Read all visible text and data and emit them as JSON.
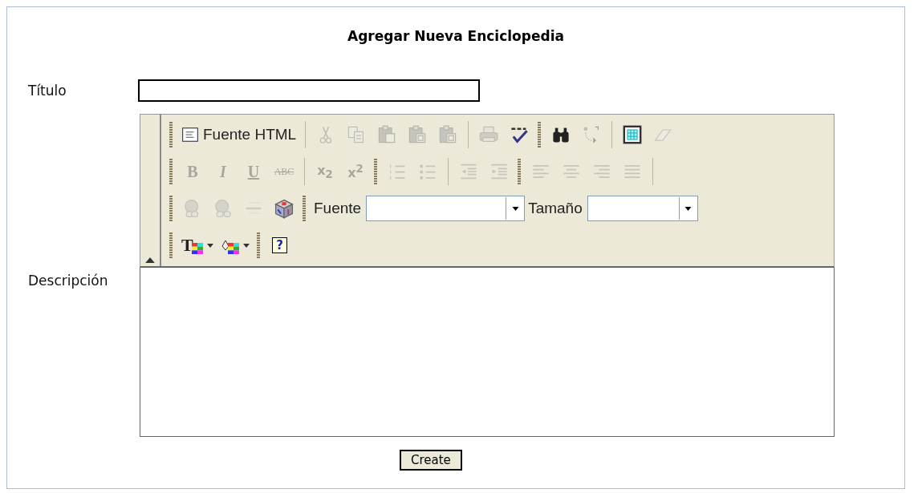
{
  "title": "Agregar Nueva Enciclopedia",
  "title_field": {
    "label": "Título"
  },
  "description_field": {
    "label": "Descripción"
  },
  "toolbar": {
    "rows": [
      {
        "items": [
          {
            "kind": "grip"
          },
          {
            "kind": "tool",
            "label": "Fuente HTML",
            "disabled": false
          },
          {
            "kind": "sep"
          },
          {
            "kind": "tool",
            "disabled": true
          },
          {
            "kind": "tool",
            "disabled": true
          },
          {
            "kind": "tool",
            "disabled": true
          },
          {
            "kind": "tool",
            "disabled": true
          },
          {
            "kind": "tool",
            "disabled": true
          },
          {
            "kind": "sep"
          },
          {
            "kind": "tool",
            "disabled": true
          },
          {
            "kind": "tool",
            "disabled": false
          },
          {
            "kind": "grip"
          },
          {
            "kind": "tool",
            "disabled": false
          },
          {
            "kind": "tool",
            "disabled": true
          },
          {
            "kind": "sep"
          },
          {
            "kind": "tool",
            "disabled": false
          },
          {
            "kind": "tool",
            "disabled": true
          }
        ]
      },
      {
        "items": [
          {
            "kind": "grip"
          },
          {
            "kind": "tool",
            "glyph": "B",
            "disabled": true
          },
          {
            "kind": "tool",
            "glyph": "I",
            "disabled": true
          },
          {
            "kind": "tool",
            "glyph": "U",
            "disabled": true
          },
          {
            "kind": "tool",
            "glyph": "ABC",
            "disabled": true
          },
          {
            "kind": "sep"
          },
          {
            "kind": "tool",
            "glyph": "x$_{2}$",
            "disabled": true
          },
          {
            "kind": "tool",
            "glyph": "x$^{2}$",
            "disabled": true
          },
          {
            "kind": "grip"
          },
          {
            "kind": "tool",
            "disabled": true
          },
          {
            "kind": "tool",
            "disabled": true
          },
          {
            "kind": "sep"
          },
          {
            "kind": "tool",
            "disabled": true
          },
          {
            "kind": "tool",
            "disabled": true
          },
          {
            "kind": "grip"
          },
          {
            "kind": "tool",
            "disabled": true
          },
          {
            "kind": "tool",
            "disabled": true
          },
          {
            "kind": "tool",
            "disabled": true
          },
          {
            "kind": "tool",
            "disabled": true
          },
          {
            "kind": "sep"
          }
        ]
      },
      {
        "items": [
          {
            "kind": "grip"
          },
          {
            "kind": "tool",
            "disabled": true
          },
          {
            "kind": "tool",
            "disabled": true
          },
          {
            "kind": "tool",
            "disabled": true
          },
          {
            "kind": "tool",
            "disabled": false
          },
          {
            "kind": "grip"
          },
          {
            "kind": "label",
            "text": "Fuente"
          },
          {
            "kind": "select"
          },
          {
            "kind": "label",
            "text": "Tamaño"
          },
          {
            "kind": "select"
          }
        ]
      },
      {
        "items": [
          {
            "kind": "grip"
          },
          {
            "kind": "tool",
            "glyph": "T",
            "dropdown": true,
            "disabled": false
          },
          {
            "kind": "tool",
            "dropdown": true,
            "disabled": false
          },
          {
            "kind": "grip"
          },
          {
            "kind": "tool",
            "glyph": "?",
            "disabled": false
          }
        ]
      }
    ]
  },
  "submit": {
    "label": "Create"
  }
}
